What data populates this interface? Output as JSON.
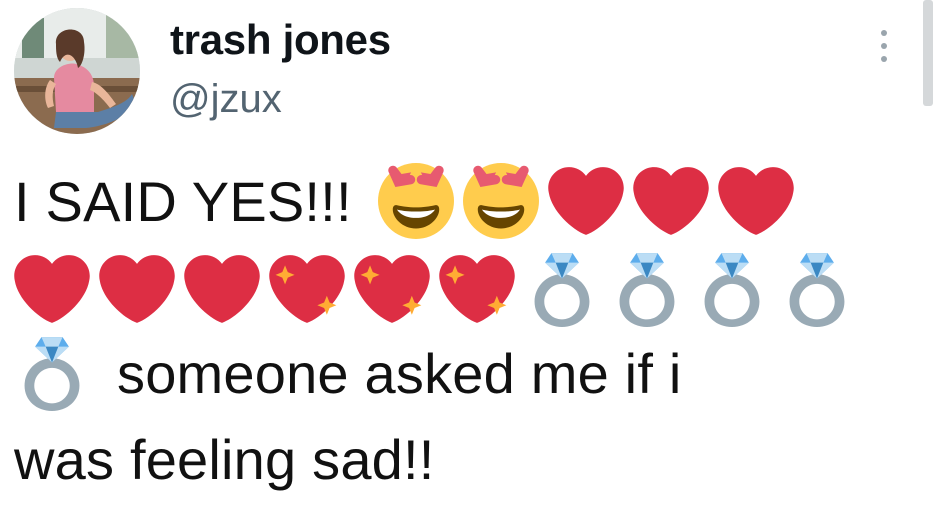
{
  "tweet": {
    "display_name": "trash jones",
    "handle": "@jzux",
    "avatar_icon": "profile-photo",
    "more_icon": "more-options-icon",
    "text_part1": "I SAID YES!!!",
    "text_part2": "someone asked me if i",
    "text_part3": "was feeling sad!!",
    "emoji_line1": [
      "smiling-face-with-heart-eyes",
      "smiling-face-with-heart-eyes",
      "red-heart",
      "red-heart",
      "red-heart"
    ],
    "emoji_line2": [
      "red-heart",
      "red-heart",
      "red-heart",
      "sparkling-heart",
      "sparkling-heart",
      "sparkling-heart",
      "ring",
      "ring",
      "ring",
      "ring"
    ],
    "emoji_line3": [
      "ring"
    ]
  },
  "colors": {
    "text": "#0f1419",
    "handle": "#536471",
    "heart": "#dd2e44",
    "face": "#ffcc4d",
    "ring_band": "#99aab5",
    "gem": "#5dadec"
  }
}
